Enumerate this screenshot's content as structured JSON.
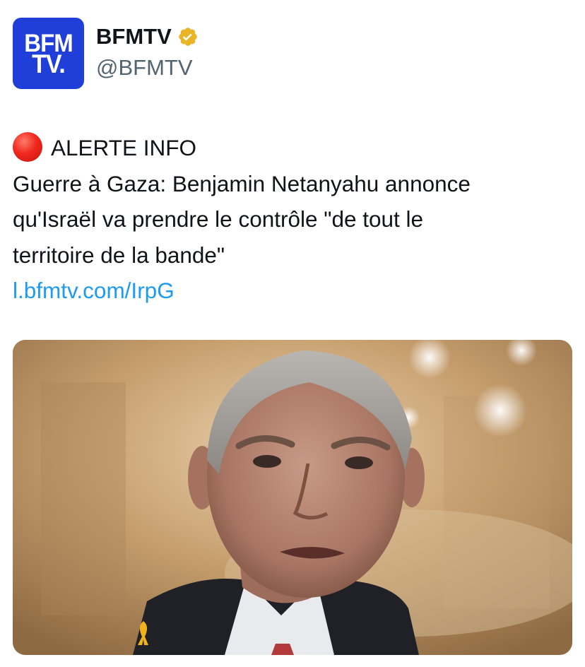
{
  "account": {
    "avatar_line1": "BFM",
    "avatar_line2": "TV.",
    "display_name": "BFMTV",
    "handle": "@BFMTV",
    "verified_color": "#e8b528",
    "avatar_color": "#1f3fd8"
  },
  "tweet": {
    "alert_icon": "red-circle-emoji",
    "alert_label": "ALERTE INFO",
    "lines": [
      "Guerre à Gaza: Benjamin Netanyahu annonce",
      "qu'Israël va prendre le contrôle \"de tout le",
      "territoire de la bande\""
    ],
    "link": "l.bfmtv.com/IrpG",
    "link_color": "#1d9bf0"
  },
  "media": {
    "description_icon": "news-photo",
    "ribbon_icon": "yellow-ribbon-pin"
  }
}
